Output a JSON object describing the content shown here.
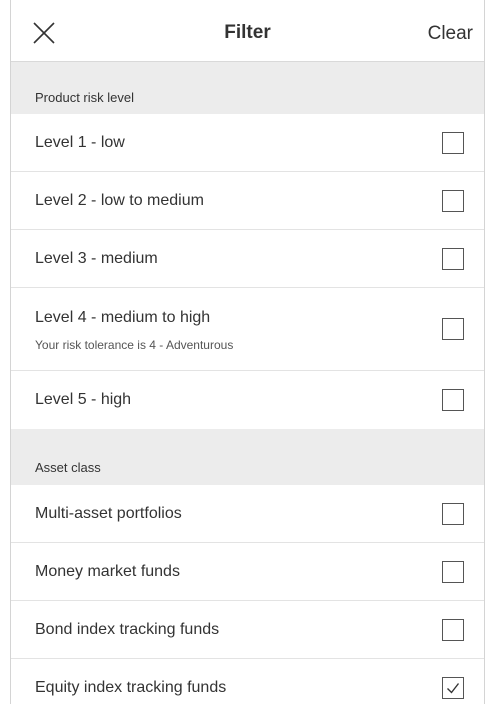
{
  "header": {
    "title": "Filter",
    "clear_label": "Clear",
    "close_icon": "close-icon"
  },
  "sections": [
    {
      "title": "Product risk level",
      "items": [
        {
          "label": "Level 1 - low",
          "checked": false
        },
        {
          "label": "Level 2 - low to medium",
          "checked": false
        },
        {
          "label": "Level 3 - medium",
          "checked": false
        },
        {
          "label": "Level 4 - medium to high",
          "sublabel": "Your risk tolerance is 4 - Adventurous",
          "checked": false
        },
        {
          "label": "Level 5 - high",
          "checked": false
        }
      ]
    },
    {
      "title": "Asset class",
      "items": [
        {
          "label": "Multi-asset portfolios",
          "checked": false
        },
        {
          "label": "Money market funds",
          "checked": false
        },
        {
          "label": "Bond index tracking funds",
          "checked": false
        },
        {
          "label": "Equity index tracking funds",
          "checked": true
        }
      ]
    }
  ],
  "colors": {
    "section_background": "#ececec",
    "text": "#333333",
    "divider": "#e3e3e3",
    "checkbox_border": "#555555"
  }
}
